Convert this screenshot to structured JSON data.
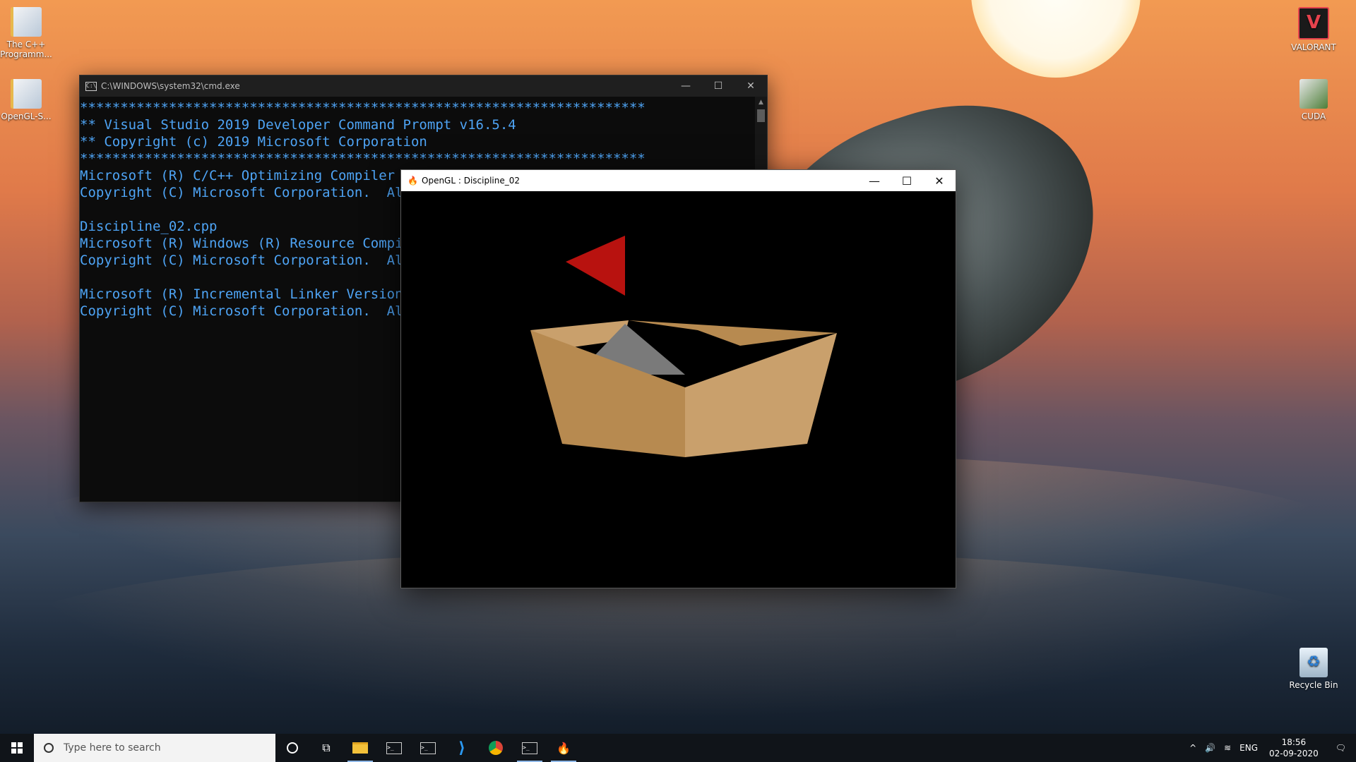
{
  "desktop": {
    "icons_left": [
      {
        "label": "The C++ Programm...",
        "icon": "book-pdf-icon"
      },
      {
        "label": "OpenGL-S...",
        "icon": "book-pdf-icon"
      }
    ],
    "icons_right": [
      {
        "label": "VALORANT",
        "icon": "valorant-icon"
      },
      {
        "label": "CUDA",
        "icon": "cuda-icon"
      },
      {
        "label": "Recycle Bin",
        "icon": "recycle-bin-icon"
      }
    ]
  },
  "cmd_window": {
    "title": "C:\\WINDOWS\\system32\\cmd.exe",
    "lines": [
      "**********************************************************************",
      "** Visual Studio 2019 Developer Command Prompt v16.5.4",
      "** Copyright (c) 2019 Microsoft Corporation",
      "**********************************************************************",
      "Microsoft (R) C/C++ Optimizing Compiler Version 19.25.28614 for x86",
      "Copyright (C) Microsoft Corporation.  All",
      "",
      "Discipline_02.cpp",
      "Microsoft (R) Windows (R) Resource Compile",
      "Copyright (C) Microsoft Corporation.  All",
      "",
      "Microsoft (R) Incremental Linker Version 1",
      "Copyright (C) Microsoft Corporation.  All"
    ],
    "text_color": "#4ea4f5"
  },
  "gl_window": {
    "title": "OpenGL : Discipline_02",
    "scene": {
      "background": "#000000",
      "flag_color": "#b8120f",
      "hull_left_color": "#b78a50",
      "hull_right_color": "#c9a06c",
      "rim_color": "#c9a06c",
      "inner_color": "#7a7a7a"
    }
  },
  "taskbar": {
    "search_placeholder": "Type here to search",
    "apps": [
      "cortana-icon",
      "task-view-icon",
      "file-explorer-icon",
      "terminal-icon",
      "terminal-icon",
      "vscode-icon",
      "chrome-icon",
      "terminal-icon",
      "opengl-app-icon"
    ],
    "tray": {
      "language": "ENG",
      "time": "18:56",
      "date": "02-09-2020"
    }
  }
}
